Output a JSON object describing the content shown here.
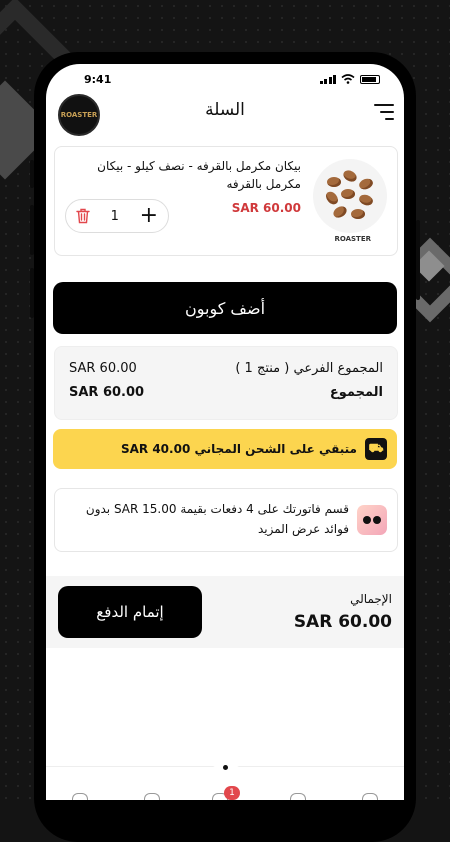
{
  "status_bar": {
    "time": "9:41"
  },
  "header": {
    "title": "السلة",
    "logo_text": "ROASTER"
  },
  "cart_item": {
    "name": "بيكان مكرمل بالقرفه - نصف كيلو - بيكان مكرمل بالقرفه",
    "price": "SAR 60.00",
    "quantity": "1",
    "brand_text": "ROASTER",
    "icons": {
      "delete": "trash-icon",
      "increase": "plus-icon"
    }
  },
  "coupon": {
    "button_label": "أضف كوبون"
  },
  "summary": {
    "subtotal_label": "المجموع الفرعي ( منتج 1 )",
    "subtotal_value": "SAR 60.00",
    "total_label": "المجموع",
    "total_value": "SAR 60.00"
  },
  "shipping_banner": {
    "text": "متبقي على الشحن المجاني SAR 40.00",
    "icon": "truck-icon",
    "color": "#fcd54f"
  },
  "installments": {
    "text": "قسم فاتورتك على 4 دفعات بقيمة SAR 15.00 بدون فوائد عرض المزيد",
    "icon": "tabby-icon"
  },
  "checkout": {
    "total_label": "الإجمالي",
    "total_value": "SAR 60.00",
    "button_label": "إتمام الدفع"
  },
  "tab_bar": {
    "cart_badge": "1",
    "accent": "#e2474c"
  }
}
